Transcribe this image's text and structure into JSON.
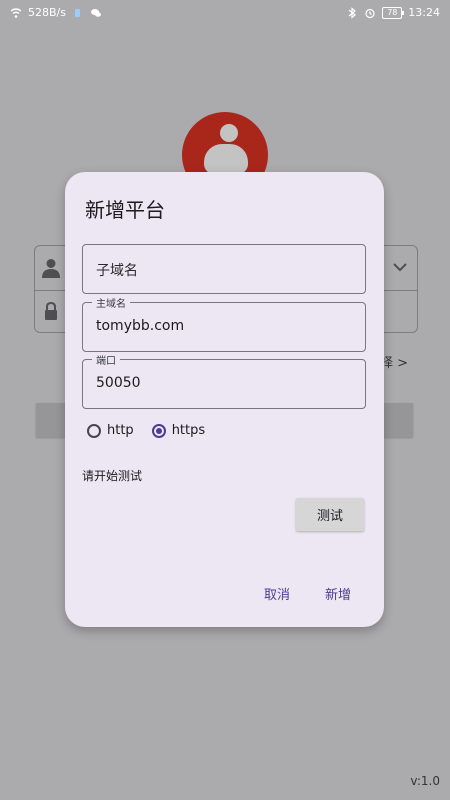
{
  "statusbar": {
    "speed": "528B/s",
    "battery": "78",
    "time": "13:24"
  },
  "login": {
    "select_hint": "择 >"
  },
  "version": "v:1.0",
  "dialog": {
    "title": "新增平台",
    "subdomain": {
      "placeholder": "子域名"
    },
    "main_domain": {
      "label": "主域名",
      "value": "tomybb.com"
    },
    "port": {
      "label": "端口",
      "value": "50050"
    },
    "protocols": [
      {
        "label": "http",
        "selected": false
      },
      {
        "label": "https",
        "selected": true
      }
    ],
    "status_text": "请开始测试",
    "test_button": "测试",
    "cancel_button": "取消",
    "add_button": "新增"
  },
  "colors": {
    "accent": "#4d3a95",
    "dialog_bg": "#ece7f2",
    "logo_red": "#a9261b"
  }
}
